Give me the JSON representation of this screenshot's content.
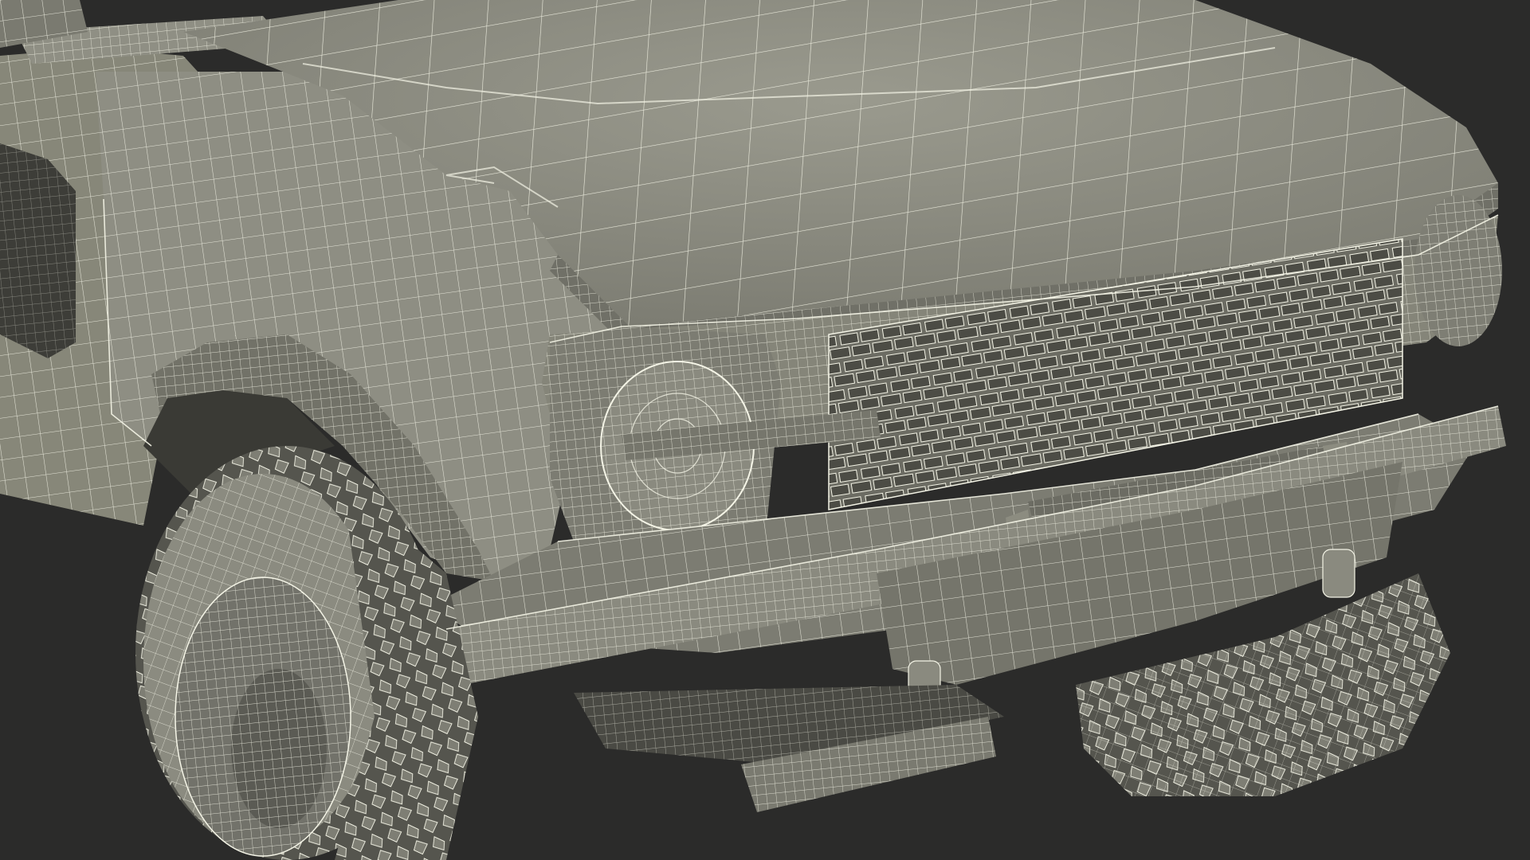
{
  "scene": {
    "subject": "wireframe-render-of-suv-front",
    "colors": {
      "background": "#2b2b2a",
      "surface": "#8e8e83",
      "surface_light": "#a3a397",
      "surface_dark": "#6f6f66",
      "shadow": "#3f3f3a",
      "wire": "#f4f4e6"
    }
  }
}
